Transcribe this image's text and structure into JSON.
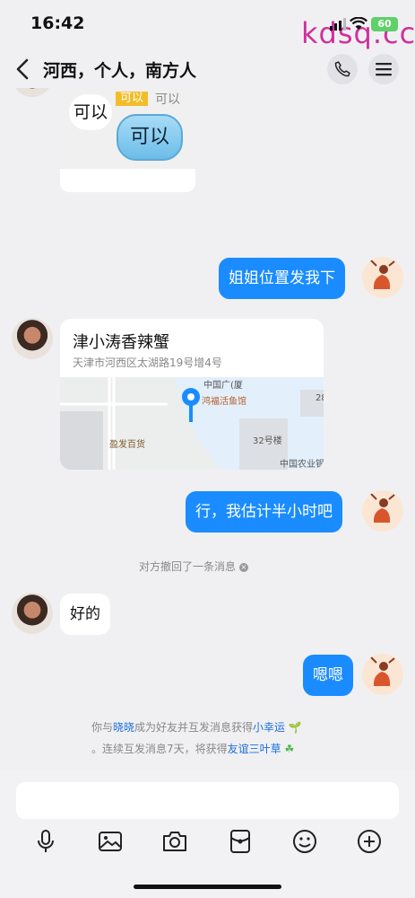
{
  "status": {
    "time": "16:42",
    "battery": "60",
    "watermark": "kdsq.cc"
  },
  "header": {
    "title": "河西，个人，南方人"
  },
  "sticker": {
    "tag": "可以",
    "tag2": "可以",
    "word1": "可以",
    "cloud_text": "可以"
  },
  "messages": {
    "out1": "姐姐位置发我下",
    "out2": "行，我估计半小时吧",
    "in1": "好的",
    "out3": "嗯嗯"
  },
  "location": {
    "name": "津小涛香辣蟹",
    "address": "天津市河西区太湖路19号增4号",
    "map_labels": [
      "中国广(厦",
      "鸿福活鱼馆",
      "盈发百货",
      "32号楼",
      "中国农业银行",
      "28"
    ]
  },
  "notices": {
    "recall": "对方撤回了一条消息",
    "line1_pre": "你与",
    "line1_name": "晓晓",
    "line1_mid": "成为好友并互发消息获得",
    "line1_badge": "小幸运",
    "line2_pre": "。连续互发消息7天，将获得",
    "line2_badge": "友谊三叶草"
  },
  "toolbar": {
    "icons": [
      "microphone-icon",
      "image-icon",
      "camera-icon",
      "red-packet-icon",
      "emoji-icon",
      "plus-icon"
    ]
  }
}
